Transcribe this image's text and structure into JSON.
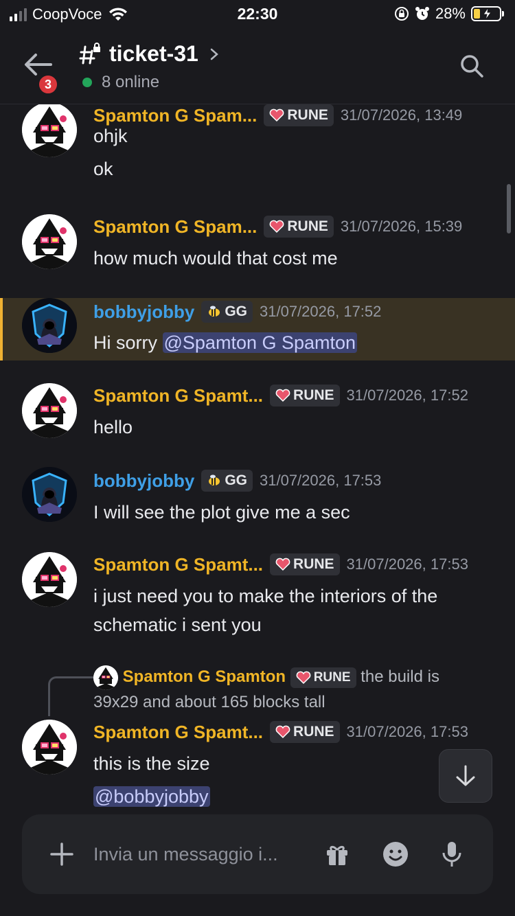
{
  "status_bar": {
    "carrier": "CoopVoce",
    "time": "22:30",
    "battery_percent": "28%"
  },
  "header": {
    "channel_name": "ticket-31",
    "notification_count": "3",
    "online": "8 online"
  },
  "messages": [
    {
      "author": "Spamton G Spam...",
      "role": "RUNE",
      "timestamp": "31/07/2026, 13:49",
      "lines": [
        "ohjk",
        "ok"
      ]
    },
    {
      "author": "Spamton G Spam...",
      "role": "RUNE",
      "timestamp": "31/07/2026, 15:39",
      "lines": [
        "how much would that cost me"
      ]
    },
    {
      "author": "bobbyjobby",
      "role": "GG",
      "timestamp": "31/07/2026, 17:52",
      "text_prefix": "Hi sorry ",
      "mention": "@Spamton G Spamton"
    },
    {
      "author": "Spamton G Spamt...",
      "role": "RUNE",
      "timestamp": "31/07/2026, 17:52",
      "lines": [
        "hello"
      ]
    },
    {
      "author": "bobbyjobby",
      "role": "GG",
      "timestamp": "31/07/2026, 17:53",
      "lines": [
        "I will see the plot give me a sec"
      ]
    },
    {
      "author": "Spamton G Spamt...",
      "role": "RUNE",
      "timestamp": "31/07/2026, 17:53",
      "lines": [
        "i just need you to make the interiors of the",
        "schematic i sent you"
      ]
    },
    {
      "reply": {
        "author": "Spamton G Spamton",
        "role": "RUNE",
        "text": "the build is 39x29 and about 165 blocks tall"
      },
      "author": "Spamton G Spamt...",
      "role": "RUNE",
      "timestamp": "31/07/2026, 17:53",
      "lines": [
        "this is the size"
      ],
      "mention": "@bobbyjobby"
    }
  ],
  "composer": {
    "placeholder": "Invia un messaggio i..."
  },
  "colors": {
    "background": "#1a1a1e",
    "author_gold": "#f0b526",
    "author_blue": "#3f9fe6",
    "online_green": "#23a55a",
    "badge_red": "#da373c",
    "highlight_bar": "#f0b232",
    "mention_bg": "#3c4270"
  }
}
